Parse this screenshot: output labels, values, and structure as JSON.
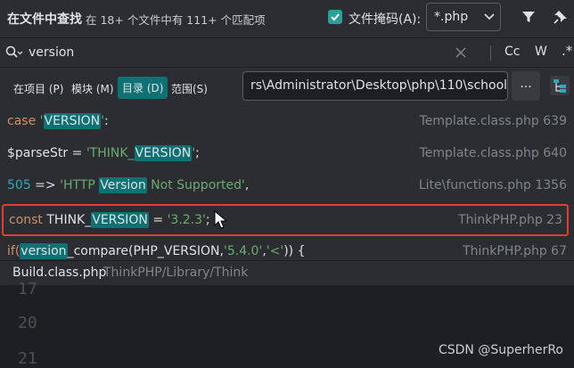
{
  "header": {
    "title": "在文件中查找",
    "summary": "在 18+ 个文件中有 111+ 个匹配项",
    "file_mask_label": "文件掩码(A):",
    "file_mask_value": "*.php"
  },
  "search": {
    "query": "version",
    "case_label": "Cc",
    "word_label": "W",
    "regex_label": ".*"
  },
  "scope": {
    "tabs": [
      "在项目 (P)",
      "模块 (M)",
      "目录 (D)",
      "范围(S)"
    ],
    "active_tab": "目录 (D)",
    "directory": "rs\\Administrator\\Desktop\\php\\110\\schoolm",
    "browse_label": "..."
  },
  "results": [
    {
      "parts": [
        {
          "t": "case ",
          "c": "kw"
        },
        {
          "t": "'",
          "c": "str"
        },
        {
          "t": "VERSION",
          "c": "hl"
        },
        {
          "t": "'",
          "c": "str"
        },
        {
          "t": ":",
          "c": ""
        }
      ],
      "file": "Template.class.php",
      "line": "639"
    },
    {
      "parts": [
        {
          "t": "$parseStr = ",
          "c": ""
        },
        {
          "t": "'THINK_",
          "c": "str"
        },
        {
          "t": "VERSION",
          "c": "hl"
        },
        {
          "t": "'",
          "c": "str"
        },
        {
          "t": ";",
          "c": ""
        }
      ],
      "file": "Template.class.php",
      "line": "640"
    },
    {
      "parts": [
        {
          "t": "505",
          "c": "num"
        },
        {
          "t": " => ",
          "c": ""
        },
        {
          "t": "'HTTP ",
          "c": "str"
        },
        {
          "t": "Version",
          "c": "hl"
        },
        {
          "t": " Not Supported'",
          "c": "str"
        },
        {
          "t": ",",
          "c": ""
        }
      ],
      "file": "Lite\\functions.php",
      "line": "1356"
    },
    {
      "parts": [
        {
          "t": "const ",
          "c": "kw"
        },
        {
          "t": "THINK_",
          "c": ""
        },
        {
          "t": "VERSION",
          "c": "hl"
        },
        {
          "t": "     =   ",
          "c": ""
        },
        {
          "t": "'3.2.3'",
          "c": "str"
        },
        {
          "t": ";",
          "c": ""
        }
      ],
      "file": "ThinkPHP.php",
      "line": "23"
    },
    {
      "parts": [
        {
          "t": "if(",
          "c": "kw"
        },
        {
          "t": "version",
          "c": "hl"
        },
        {
          "t": "_compare(PHP_VERSION,",
          "c": ""
        },
        {
          "t": "'5.4.0'",
          "c": "str"
        },
        {
          "t": ",",
          "c": ""
        },
        {
          "t": "'<'",
          "c": "str"
        },
        {
          "t": ")) {",
          "c": ""
        }
      ],
      "file": "ThinkPHP.php",
      "line": "67"
    }
  ],
  "preview": {
    "file": "Build.class.php",
    "path": "ThinkPHP/Library/Think",
    "line_numbers": [
      "17",
      "20",
      "21"
    ]
  },
  "watermark": "CSDN @SuperherRo",
  "colors": {
    "accent": "#0e7275",
    "checkbox": "#2aa198",
    "highlight_border": "#e33a3a",
    "background": "#2b2d30"
  }
}
